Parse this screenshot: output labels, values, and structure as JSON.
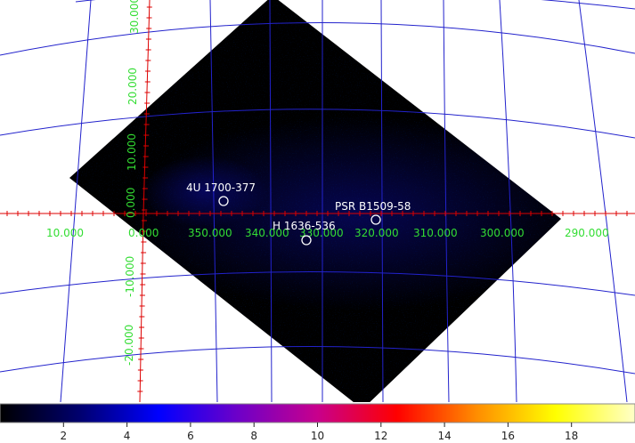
{
  "longitude_labels": [
    "10.000",
    "0.000",
    "350.000",
    "340.000",
    "330.000",
    "320.000",
    "310.000",
    "300.000",
    "290.000"
  ],
  "latitude_labels": [
    "30.000",
    "20.000",
    "10.000",
    "0.000",
    "-10.000",
    "-20.000"
  ],
  "sources": [
    {
      "name": "4U 1700-377"
    },
    {
      "name": "PSR B1509-58"
    },
    {
      "name": "H 1636-536"
    }
  ],
  "colorbar": {
    "ticks": [
      2,
      4,
      6,
      8,
      10,
      12,
      14,
      16,
      18
    ],
    "range": [
      0,
      20
    ],
    "colormap": [
      "#000000",
      "#00006e",
      "#0000ff",
      "#6e00c8",
      "#c8008c",
      "#ff0000",
      "#ff8c00",
      "#ffff00",
      "#ffffc8"
    ]
  },
  "colors": {
    "grid": "#2222cc",
    "axis": "#dd0000",
    "label": "#33dd33",
    "source": "#ffffff"
  }
}
